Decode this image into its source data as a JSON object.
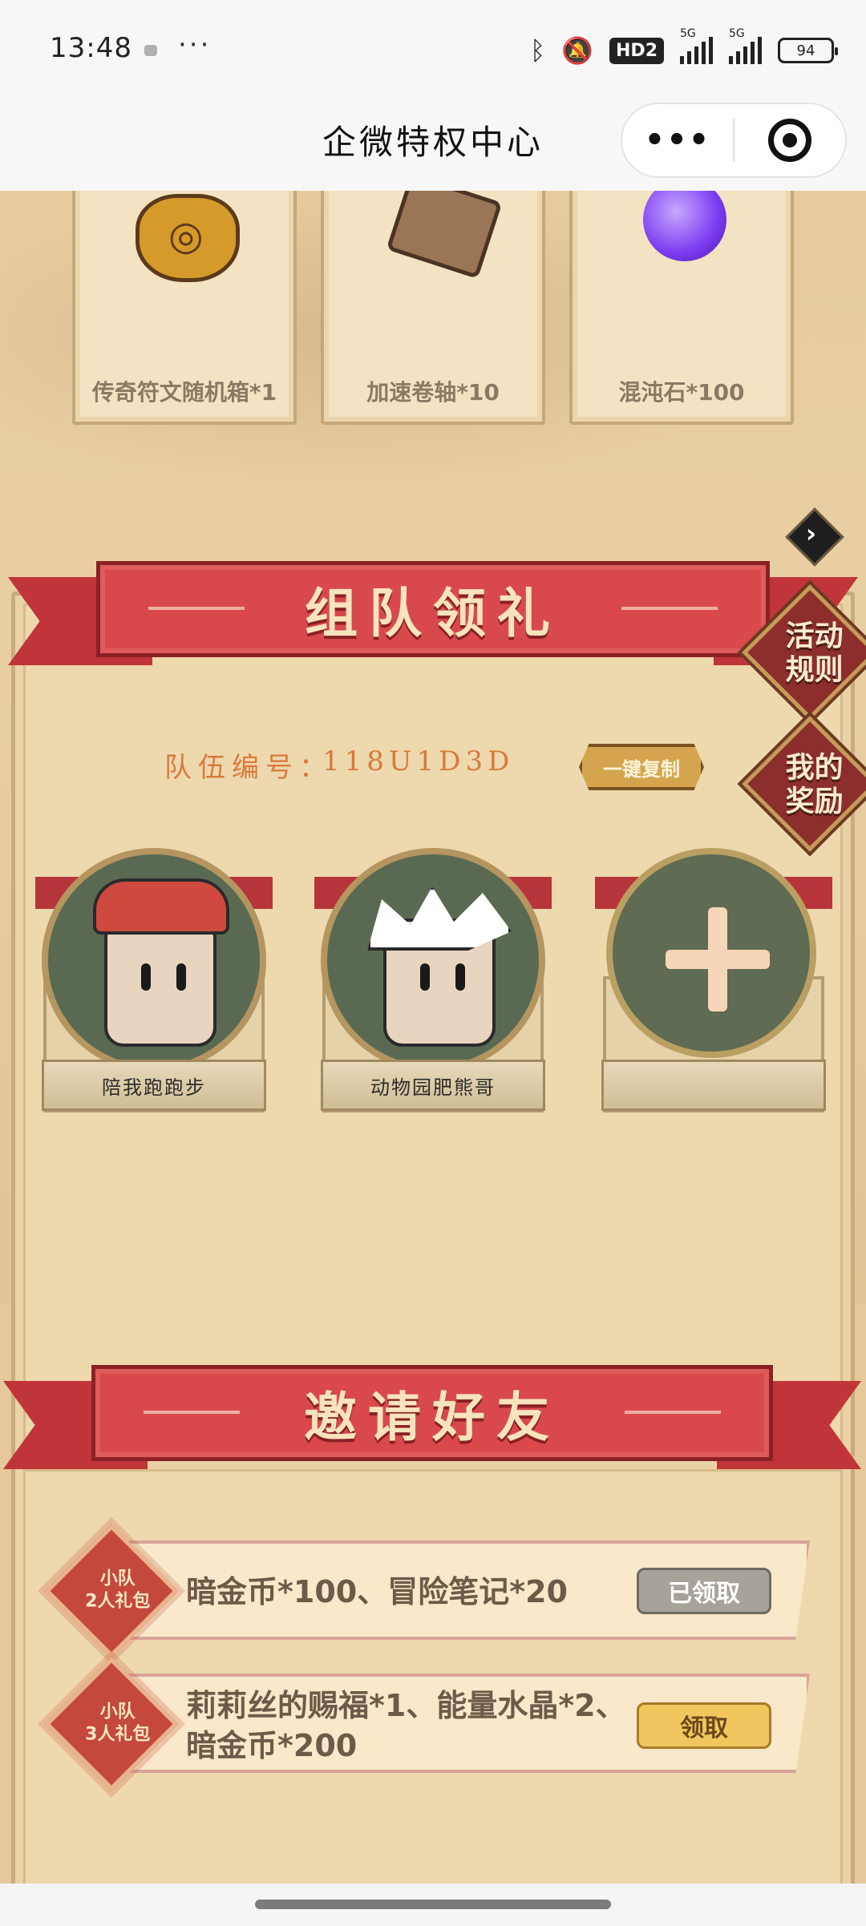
{
  "status_bar": {
    "time": "13:48",
    "more": "···",
    "hd": "HD2",
    "network1": "5G",
    "network2": "5G",
    "battery": "94",
    "icons": [
      "bluetooth-icon",
      "mute-icon"
    ]
  },
  "nav": {
    "title": "企微特权中心",
    "more_label": "•••"
  },
  "rewards": [
    {
      "label": "传奇符文随机箱*1",
      "icon": "coin-bag-icon"
    },
    {
      "label": "加速卷轴*10",
      "icon": "scroll-icon"
    },
    {
      "label": "混沌石*100",
      "icon": "purple-orb-icon"
    }
  ],
  "team": {
    "banner_title": "组队领礼",
    "rules_button": "活动\n规则",
    "my_rewards_button": "我的\n奖励",
    "team_id_label": "队伍编号：",
    "team_id_value": "118U1D3D",
    "copy_button": "一键复制",
    "members": [
      {
        "name": "陪我跑跑步"
      },
      {
        "name": "动物园肥熊哥"
      },
      {
        "name": ""
      }
    ]
  },
  "invite": {
    "banner_title": "邀请好友",
    "gifts": [
      {
        "badge": "小队\n2人礼包",
        "rewards": "暗金币*100、冒险笔记*20",
        "button": "已领取",
        "claimed": true
      },
      {
        "badge": "小队\n3人礼包",
        "rewards_line1": "莉莉丝的赐福*1、能量水晶*2、",
        "rewards_line2": "暗金币*200",
        "button": "领取",
        "claimed": false
      }
    ]
  },
  "colors": {
    "banner_red": "#d9494b",
    "parchment": "#eed8ae",
    "team_id_orange": "#d87a3c",
    "claim_yellow": "#f2c65e",
    "claimed_gray": "#a8a39a"
  }
}
